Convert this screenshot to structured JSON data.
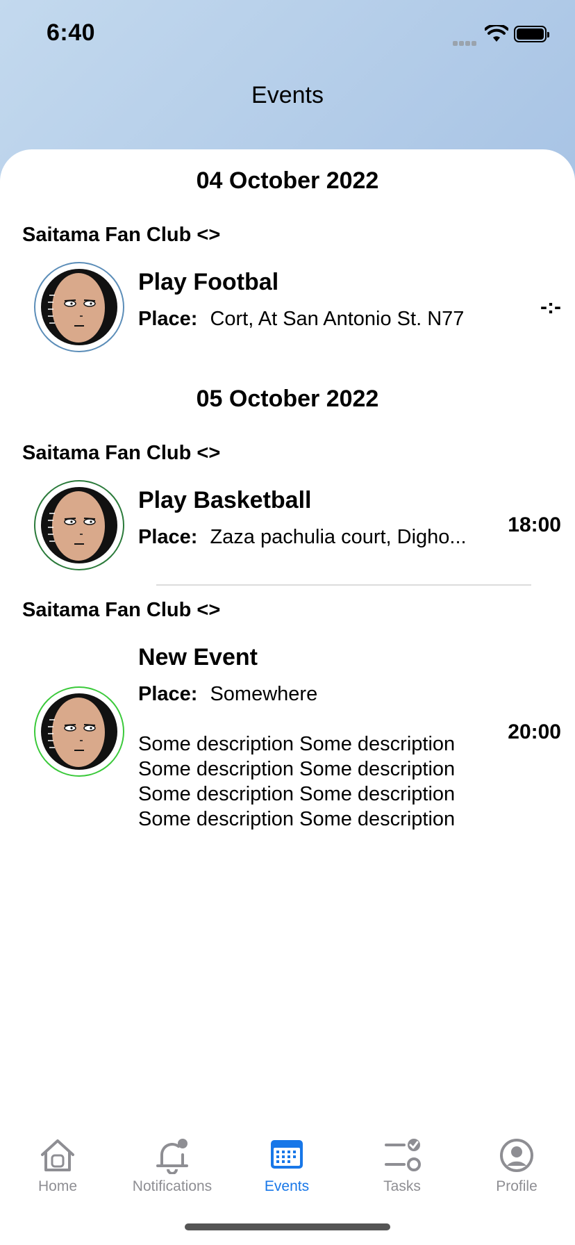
{
  "status": {
    "time": "6:40"
  },
  "header": {
    "title": "Events"
  },
  "groups": [
    {
      "date": "04 October 2022",
      "events": [
        {
          "club": "Saitama Fan Club <>",
          "title": "Play Footbal",
          "place_label": "Place:",
          "place": "Cort, At San Antonio St. N77",
          "time": "-:-",
          "ring_color": "#5b8db8"
        }
      ]
    },
    {
      "date": "05 October 2022",
      "events": [
        {
          "club": "Saitama Fan Club <>",
          "title": "Play Basketball",
          "place_label": "Place:",
          "place": "Zaza pachulia court, Digho...",
          "time": "18:00",
          "ring_color": "#2a7a3a"
        },
        {
          "club": "Saitama Fan Club <>",
          "title": "New Event",
          "place_label": "Place:",
          "place": "Somewhere",
          "time": "20:00",
          "ring_color": "#3ac93a",
          "description": [
            "Some description Some description",
            "Some description Some description",
            "Some description Some description",
            "Some description Some description"
          ]
        }
      ]
    }
  ],
  "tabs": [
    {
      "label": "Home",
      "icon": "house-icon",
      "active": false
    },
    {
      "label": "Notifications",
      "icon": "bell-icon",
      "active": false
    },
    {
      "label": "Events",
      "icon": "calendar-icon",
      "active": true
    },
    {
      "label": "Tasks",
      "icon": "tasks-icon",
      "active": false
    },
    {
      "label": "Profile",
      "icon": "profile-icon",
      "active": false
    }
  ],
  "colors": {
    "accent": "#1877e8",
    "inactive": "#8e8e93"
  }
}
